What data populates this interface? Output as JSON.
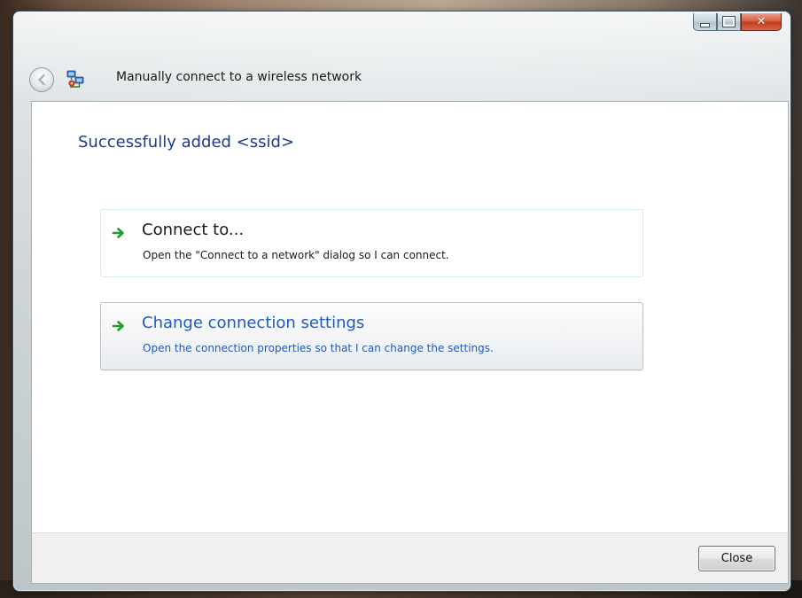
{
  "window": {
    "title": "Manually connect to a wireless network"
  },
  "icons": {
    "back": "back-arrow-icon",
    "wizard": "wireless-network-icon",
    "command_arrow": "green-arrow-icon",
    "minimize": "minimize-icon",
    "maximize": "maximize-icon",
    "close": "close-icon"
  },
  "main": {
    "instruction": "Successfully added <ssid>",
    "command_links": [
      {
        "title": "Connect to...",
        "description": "Open the \"Connect to a network\" dialog so I can connect."
      },
      {
        "title": "Change connection settings",
        "description": "Open the connection properties so that I can change the settings."
      }
    ]
  },
  "footer": {
    "close_label": "Close"
  },
  "colors": {
    "instruction_text": "#1e3b8a",
    "link_hover_text": "#1e5bbf",
    "arrow_green": "#1f9d2e",
    "close_button_red": "#c23a1c"
  }
}
